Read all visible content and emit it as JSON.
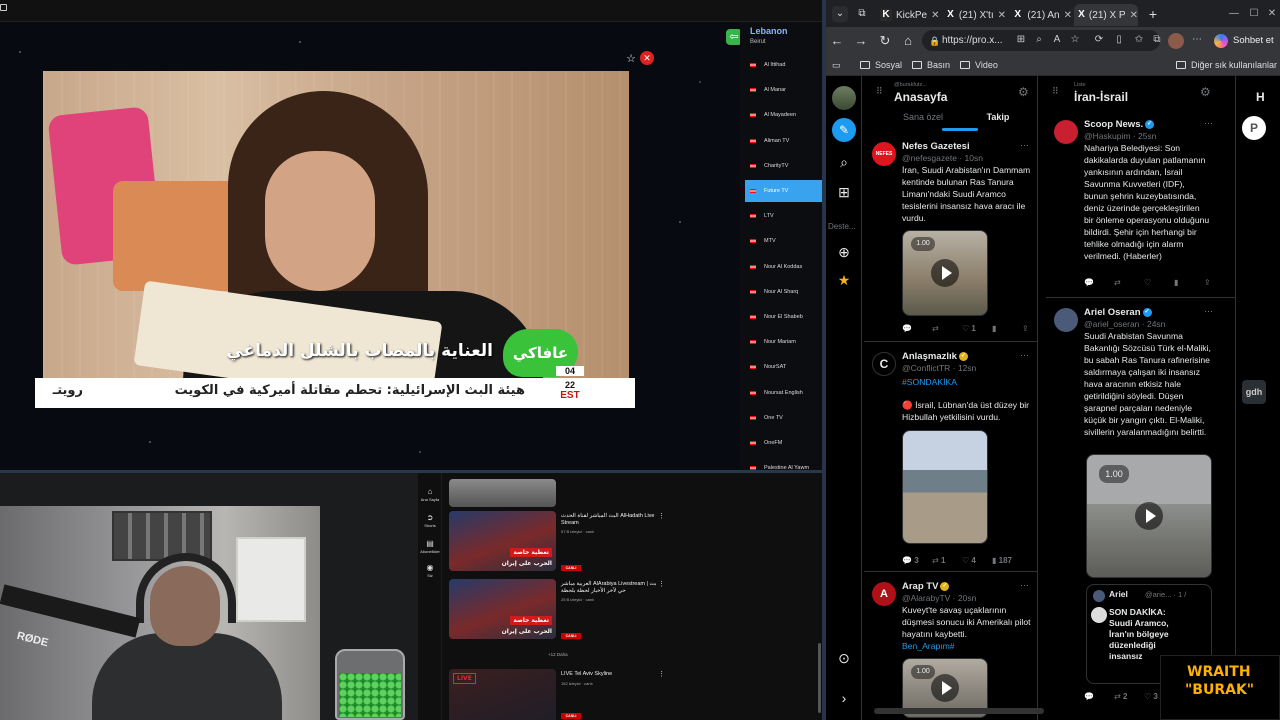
{
  "tv": {
    "country": "Lebanon",
    "city": "Beirut",
    "channels": [
      {
        "name": "Al Ittihad"
      },
      {
        "name": "Al Manar"
      },
      {
        "name": "Al Mayadeen"
      },
      {
        "name": "Aliman TV"
      },
      {
        "name": "CharityTV"
      },
      {
        "name": "Future TV",
        "active": true
      },
      {
        "name": "LTV"
      },
      {
        "name": "MTV"
      },
      {
        "name": "Nour Al Koddas"
      },
      {
        "name": "Nour Al Sharq"
      },
      {
        "name": "Nour El Shabeb"
      },
      {
        "name": "Nour Mariam"
      },
      {
        "name": "NourSAT"
      },
      {
        "name": "Noursat English"
      },
      {
        "name": "One TV"
      },
      {
        "name": "OneFM"
      },
      {
        "name": "Palestine Al Yawm"
      }
    ],
    "video_caption": "العناية بالمصاب بالشلل الدماغي",
    "channel_logo": "عافاكي",
    "ticker_text": "هيئة البث الإسرائيلية: تحطم مقاتلة أميركية في الكويت",
    "ticker_partial": "رويتـ",
    "clock_time": "04",
    "clock_day": "22",
    "clock_tz": "EST"
  },
  "webcam": {
    "mic_brand": "RØDE"
  },
  "youtube": {
    "nav": [
      "Ana Sayfa",
      "Shorts",
      "Abonelikler",
      "Siz"
    ],
    "videos": [
      {
        "title": "البث المباشر لقناة الحدث AlHadath Live Stream",
        "meta": "57 B izleyici · canlı",
        "badge": "CANLI",
        "thumb_label": "تغطية خاصة",
        "thumb_sub": "الحرب على إيران"
      },
      {
        "title": "العربية مباشر AlArabiya Livestream | بث حي لآخر الأخبار لحظة بلحظة",
        "meta": "25 B izleyici · canlı",
        "badge": "CANLI",
        "thumb_label": "تغطية خاصة",
        "thumb_sub": "الحرب على إيران"
      },
      {
        "title": "LIVE Tel Aviv Skyline",
        "meta": "152 izleyici · canlı",
        "badge": "CANLI",
        "thumb_label": "LIVE",
        "thumb_sub": ""
      }
    ],
    "more_label": "+12 Daha"
  },
  "browser": {
    "tabs": [
      {
        "title": "KickPe",
        "icon": "kick-icon",
        "active": false
      },
      {
        "title": "(21) X'tı",
        "icon": "x-icon",
        "active": false
      },
      {
        "title": "(21) An",
        "icon": "x-icon",
        "active": false
      },
      {
        "title": "(21) X P",
        "icon": "x-icon",
        "active": true
      }
    ],
    "url": "https://pro.x...",
    "copilot_label": "Sohbet et",
    "bookmarks": [
      "Sosyal",
      "Basın",
      "Video"
    ],
    "other_bookmarks": "Diğer sık kullanılanlar"
  },
  "deck": {
    "rail_text": "Deste...",
    "col1": {
      "sub": "@burakfutz...",
      "title": "Anasayfa",
      "tabs": [
        "Sana özel",
        "Takip"
      ],
      "tweets": [
        {
          "name": "Nefes Gazetesi",
          "handle": "@nefesgazete · 10sn",
          "text": "İran, Suudi Arabistan'ın Dammam kentinde bulunan Ras Tanura Limanı'ndaki Suudi Aramco tesislerini insansız hava aracı ile vurdu.",
          "speed": "1.00",
          "actions": [
            "",
            "",
            "1",
            "",
            ""
          ],
          "avatar_color": "#e0141e",
          "avatar_text": "NEFES"
        },
        {
          "name": "Anlaşmazlık",
          "handle": "@ConflictTR · 12sn",
          "hashtag": "#SONDAKİKA",
          "text": "🔴 İsrail, Lübnan'da üst düzey bir Hizbullah yetkilisini vurdu.",
          "actions": [
            "3",
            "1",
            "4",
            "187",
            ""
          ],
          "avatar_color": "#e7e9ea",
          "avatar_text": "C"
        },
        {
          "name": "Arap TV",
          "handle": "@AlarabyTV · 20sn",
          "text": "Kuveyt'te savaş uçaklarının düşmesi sonucu iki Amerikalı pilot hayatını kaybetti.",
          "mention": "Ben_Arapım#",
          "speed": "1.00",
          "avatar_color": "#b01018",
          "avatar_text": "A"
        }
      ]
    },
    "col2": {
      "sub": "Liste",
      "title": "İran-İsrail",
      "tweets": [
        {
          "name": "Scoop News.",
          "handle": "@Haskupim · 25sn",
          "text": "Nahariya Belediyesi: Son dakikalarda duyulan patlamanın yankısının ardından, İsrail Savunma Kuvvetleri (IDF), bunun şehrin kuzeybatısında, deniz üzerinde gerçekleştirilen bir önleme operasyonu olduğunu bildirdi. Şehir için herhangi bir tehlike olmadığı için alarm verilmedi. (Haberler)",
          "actions": [
            "",
            "",
            "",
            "",
            ""
          ],
          "avatar_color": "#c82030"
        },
        {
          "name": "Ariel Oseran",
          "handle": "@ariel_oseran · 24sn",
          "text": "Suudi Arabistan Savunma Bakanlığı Sözcüsü Türk el-Maliki, bu sabah Ras Tanura rafinerisine saldırmaya çalışan iki insansız hava aracının etkisiz hale getirildiğini söyledi. Düşen şarapnel parçaları nedeniyle küçük bir yangın çıktı. El-Maliki, sivillerin yaralanmadığını belirtti.",
          "speed": "1.00",
          "quote_name": "Ariel",
          "quote_handle": "@arie... · 1 /",
          "quote_text": "SON DAKİKA: Suudi Aramco, İran'ın bölgeye düzenlediği insansız",
          "actions": [
            "",
            "2",
            "3",
            "",
            ""
          ],
          "avatar_color": "#4a5a78"
        }
      ]
    },
    "col3_initial": "H"
  },
  "overlay": {
    "line1": "WRAITH",
    "line2": "\"BURAK\""
  }
}
